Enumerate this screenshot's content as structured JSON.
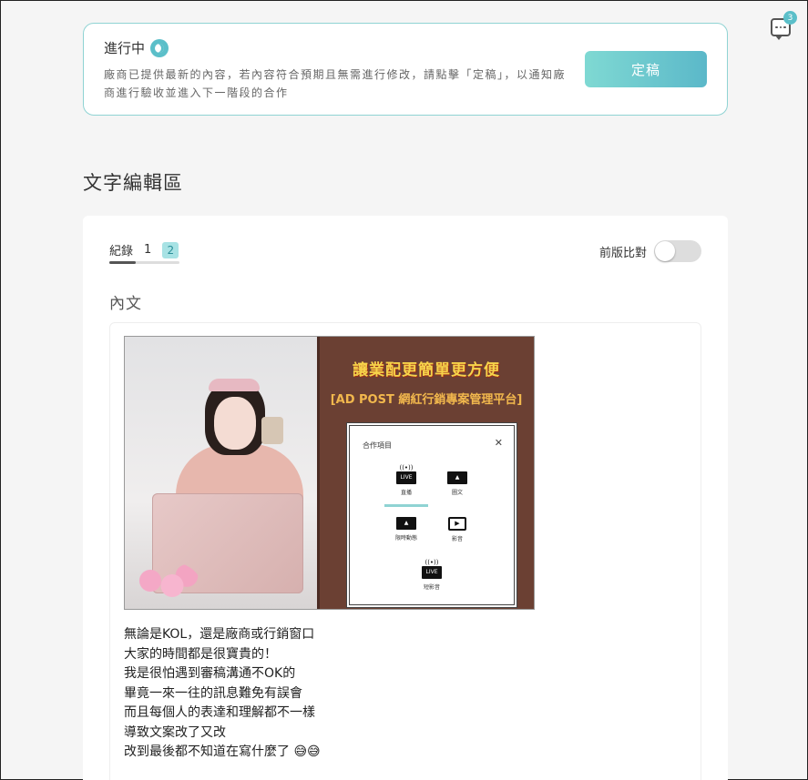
{
  "status": {
    "title": "進行中",
    "description": "廠商已提供最新的內容，若內容符合預期且無需進行修改，請點擊「定稿」，以通知廠商進行驗收並進入下一階段的合作",
    "button_label": "定稿"
  },
  "section_title": "文字編輯區",
  "versions": {
    "label": "紀錄",
    "items": [
      "1",
      "2"
    ],
    "active": "2"
  },
  "compare": {
    "label": "前版比對",
    "enabled": false
  },
  "content_label": "內文",
  "image": {
    "headline": "讓業配更簡單更方便",
    "subtitle": "[AD POST 網紅行銷專案管理平台]",
    "modal_title": "合作項目",
    "options": [
      {
        "icon": "live-icon",
        "badge": "LIVE",
        "label": "直播"
      },
      {
        "icon": "image-icon",
        "badge": "",
        "label": "圖文"
      },
      {
        "icon": "image-icon",
        "badge": "",
        "label": "限時動態"
      },
      {
        "icon": "tv-icon",
        "badge": "",
        "label": "影音"
      },
      {
        "icon": "live-icon",
        "badge": "LIVE",
        "label": "短影音"
      }
    ]
  },
  "post_lines": [
    "無論是KOL，還是廠商或行銷窗口",
    "大家的時間都是很寶貴的！",
    "我是很怕遇到審稿溝通不OK的",
    "畢竟一來一往的訊息難免有誤會",
    "而且每個人的表達和理解都不一樣",
    "導致文案改了又改",
    "改到最後都不知道在寫什麼了 😅😅"
  ],
  "chat": {
    "badge": "3"
  },
  "colors": {
    "accent": "#5bbfc9",
    "border": "#8fd3d3"
  }
}
